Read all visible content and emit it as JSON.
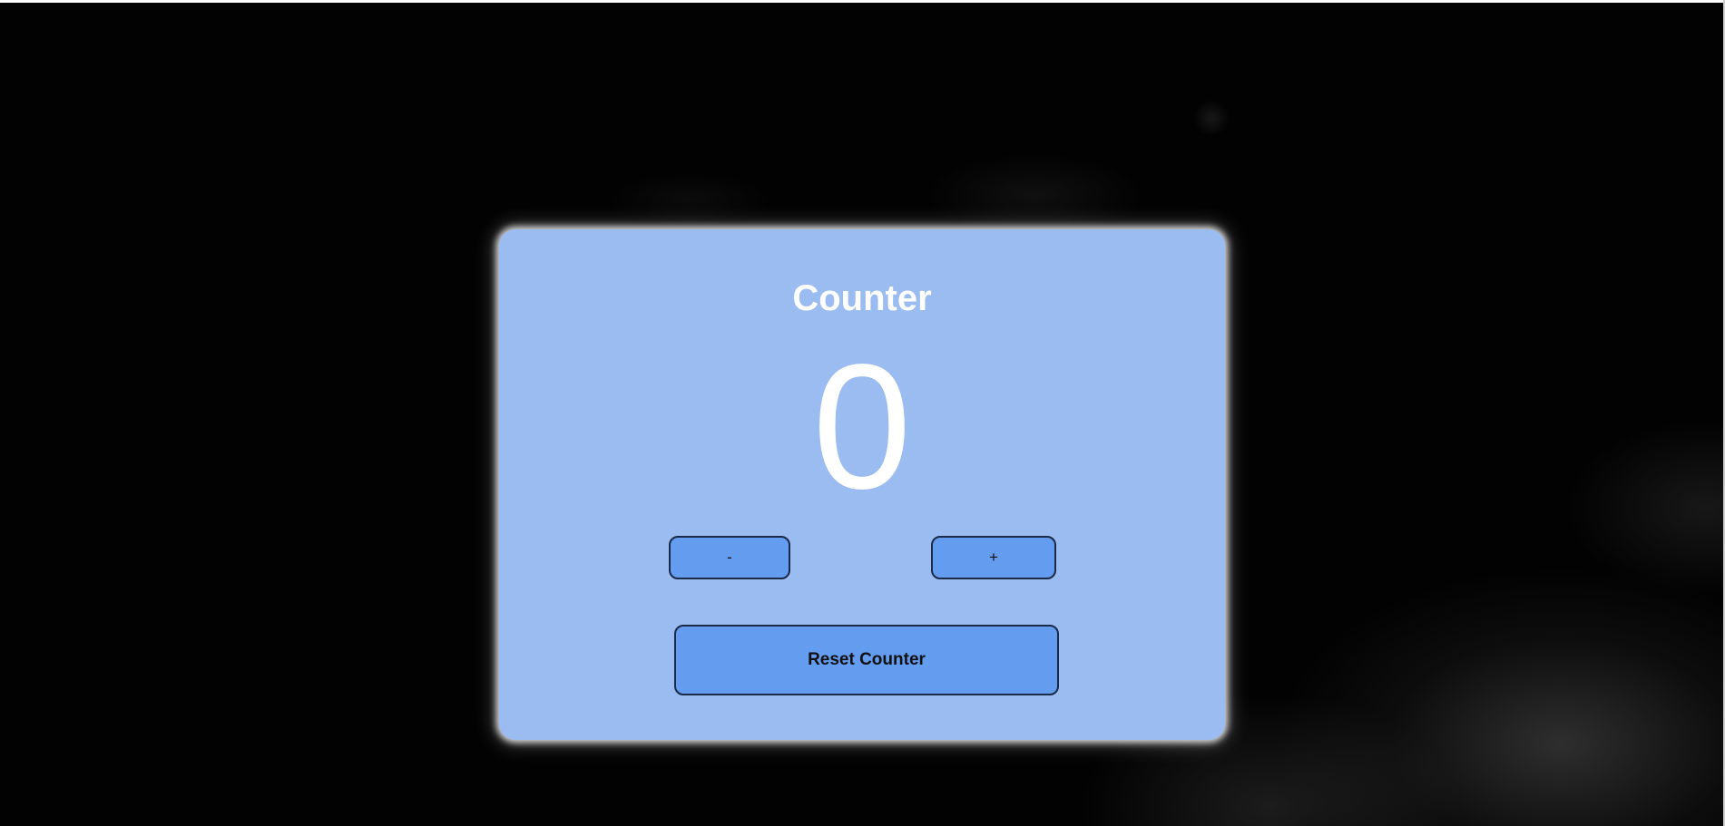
{
  "counter": {
    "title": "Counter",
    "value": "0",
    "decrement_label": "-",
    "increment_label": "+",
    "reset_label": "Reset Counter"
  },
  "colors": {
    "background": "#000000",
    "card": "#9bbcf0",
    "button": "#649cf0",
    "text": "#ffffff"
  }
}
